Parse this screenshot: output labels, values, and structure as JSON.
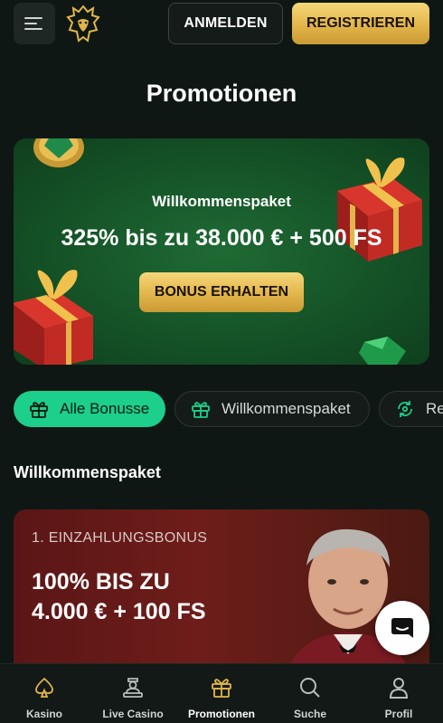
{
  "header": {
    "login_label": "ANMELDEN",
    "register_label": "REGISTRIEREN"
  },
  "page": {
    "title": "Promotionen"
  },
  "hero": {
    "subtitle": "Willkommenspaket",
    "title": "325% bis zu 38.000 € + 500 FS",
    "cta_label": "BONUS ERHALTEN"
  },
  "chips": [
    {
      "label": "Alle Bonusse",
      "icon": "gift-icon",
      "active": true
    },
    {
      "label": "Willkommenspaket",
      "icon": "gift-box-icon",
      "active": false
    },
    {
      "label": "Re",
      "icon": "refresh-icon",
      "active": false
    }
  ],
  "section": {
    "title": "Willkommenspaket"
  },
  "card": {
    "label": "1. EINZAHLUNGSBONUS",
    "title_line1": "100% BIS ZU",
    "title_line2": "4.000 € + 100 FS"
  },
  "nav": [
    {
      "label": "Kasino",
      "icon": "spade-icon"
    },
    {
      "label": "Live Casino",
      "icon": "dealer-icon"
    },
    {
      "label": "Promotionen",
      "icon": "gift-icon"
    },
    {
      "label": "Suche",
      "icon": "search-icon"
    },
    {
      "label": "Profil",
      "icon": "user-icon"
    }
  ],
  "colors": {
    "background": "#0f1714",
    "accent_green": "#1ccf8a",
    "gold": "#e2b54a"
  }
}
